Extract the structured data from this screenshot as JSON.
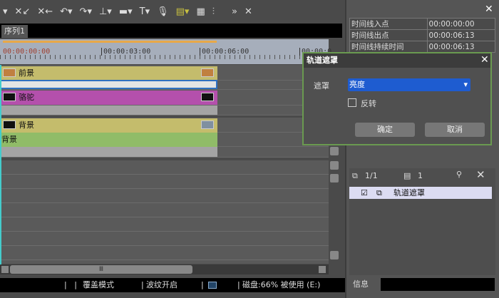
{
  "toolbar": {
    "icons": [
      "dropdown",
      "delete-ripple",
      "delete",
      "undo",
      "redo",
      "split",
      "mark",
      "title",
      "voice",
      "mixer-output",
      "grid",
      "audio-mixer",
      "more",
      "close"
    ]
  },
  "sequence_tab": "序列1",
  "ruler": {
    "timecodes": [
      "00:00:00:00",
      "00:00:03:00",
      "00:00:06:00",
      "00:00:0"
    ]
  },
  "tracks": {
    "foreground": "前景",
    "camel": "骆驼",
    "background_clip": "背景",
    "background_green": "背景"
  },
  "status": {
    "overwrite": "覆盖模式",
    "ripple": "波纹开启",
    "disk": "磁盘:66% 被使用 (E:)"
  },
  "info": {
    "rows": [
      {
        "label": "时间线入点",
        "value": "00:00:00:00"
      },
      {
        "label": "时间线出点",
        "value": "00:00:06:13"
      },
      {
        "label": "时间线持续时间",
        "value": "00:00:06:13"
      }
    ]
  },
  "dialog": {
    "title": "轨道遮罩",
    "mask_label": "遮罩",
    "mask_value": "亮度",
    "invert_label": "反转",
    "invert_checked": false,
    "ok": "确定",
    "cancel": "取消"
  },
  "effects": {
    "layer_count": "1/1",
    "count": "1",
    "item": "轨道遮罩",
    "item_checked": true
  },
  "info_tab": "信息",
  "colors": {
    "clip_yellow": "#c4bc6c",
    "clip_magenta": "#b450ac",
    "clip_green": "#90bc68",
    "accent_blue": "#1e5cd0",
    "dialog_border": "#6a9a50"
  }
}
